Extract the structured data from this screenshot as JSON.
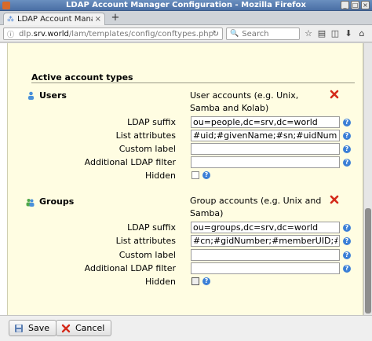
{
  "window": {
    "title": "LDAP Account Manager Configuration - Mozilla Firefox"
  },
  "tab": {
    "title": "LDAP Account Manag...",
    "new_tab": "+"
  },
  "navbar": {
    "url_prefix": "dlp.",
    "url_domain": "srv.world",
    "url_path": "/lam/templates/config/conftypes.php",
    "search_placeholder": "Search"
  },
  "section": {
    "title": "Active account types"
  },
  "account_types": [
    {
      "name": "Users",
      "description": "User accounts (e.g. Unix, Samba and Kolab)",
      "fields": {
        "ldap_suffix_label": "LDAP suffix",
        "ldap_suffix_value": "ou=people,dc=srv,dc=world",
        "list_attributes_label": "List attributes",
        "list_attributes_value": "#uid;#givenName;#sn;#uidNumber;#gidNumber",
        "custom_label_label": "Custom label",
        "custom_label_value": "",
        "additional_filter_label": "Additional LDAP filter",
        "additional_filter_value": "",
        "hidden_label": "Hidden"
      }
    },
    {
      "name": "Groups",
      "description": "Group accounts (e.g. Unix and Samba)",
      "fields": {
        "ldap_suffix_label": "LDAP suffix",
        "ldap_suffix_value": "ou=groups,dc=srv,dc=world",
        "list_attributes_label": "List attributes",
        "list_attributes_value": "#cn;#gidNumber;#memberUID;#description",
        "custom_label_label": "Custom label",
        "custom_label_value": "",
        "additional_filter_label": "Additional LDAP filter",
        "additional_filter_value": "",
        "hidden_label": "Hidden"
      }
    }
  ],
  "buttons": {
    "save": "Save",
    "cancel": "Cancel"
  },
  "icons": {
    "help": "?",
    "delete_color": "#d42a1a",
    "help_color": "#3b7fd6"
  }
}
